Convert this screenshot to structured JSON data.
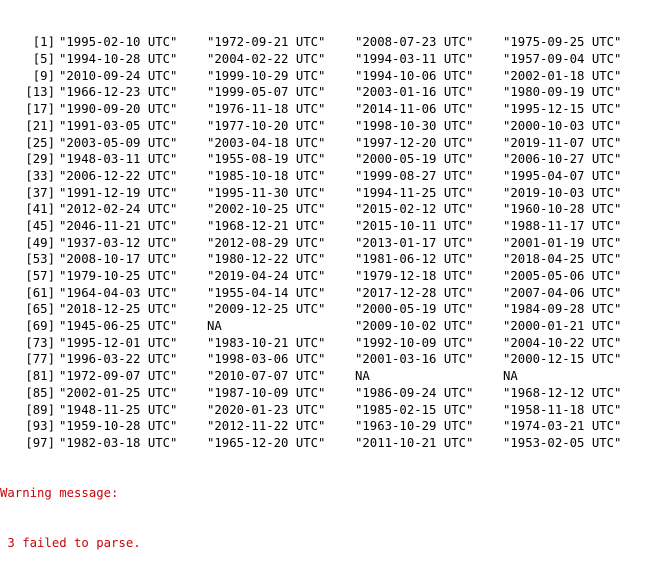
{
  "console": {
    "rows": [
      {
        "index": "[1]",
        "values": [
          "\"1995-02-10 UTC\"",
          "\"1972-09-21 UTC\"",
          "\"2008-07-23 UTC\"",
          "\"1975-09-25 UTC\""
        ]
      },
      {
        "index": "[5]",
        "values": [
          "\"1994-10-28 UTC\"",
          "\"2004-02-22 UTC\"",
          "\"1994-03-11 UTC\"",
          "\"1957-09-04 UTC\""
        ]
      },
      {
        "index": "[9]",
        "values": [
          "\"2010-09-24 UTC\"",
          "\"1999-10-29 UTC\"",
          "\"1994-10-06 UTC\"",
          "\"2002-01-18 UTC\""
        ]
      },
      {
        "index": "[13]",
        "values": [
          "\"1966-12-23 UTC\"",
          "\"1999-05-07 UTC\"",
          "\"2003-01-16 UTC\"",
          "\"1980-09-19 UTC\""
        ]
      },
      {
        "index": "[17]",
        "values": [
          "\"1990-09-20 UTC\"",
          "\"1976-11-18 UTC\"",
          "\"2014-11-06 UTC\"",
          "\"1995-12-15 UTC\""
        ]
      },
      {
        "index": "[21]",
        "values": [
          "\"1991-03-05 UTC\"",
          "\"1977-10-20 UTC\"",
          "\"1998-10-30 UTC\"",
          "\"2000-10-03 UTC\""
        ]
      },
      {
        "index": "[25]",
        "values": [
          "\"2003-05-09 UTC\"",
          "\"2003-04-18 UTC\"",
          "\"1997-12-20 UTC\"",
          "\"2019-11-07 UTC\""
        ]
      },
      {
        "index": "[29]",
        "values": [
          "\"1948-03-11 UTC\"",
          "\"1955-08-19 UTC\"",
          "\"2000-05-19 UTC\"",
          "\"2006-10-27 UTC\""
        ]
      },
      {
        "index": "[33]",
        "values": [
          "\"2006-12-22 UTC\"",
          "\"1985-10-18 UTC\"",
          "\"1999-08-27 UTC\"",
          "\"1995-04-07 UTC\""
        ]
      },
      {
        "index": "[37]",
        "values": [
          "\"1991-12-19 UTC\"",
          "\"1995-11-30 UTC\"",
          "\"1994-11-25 UTC\"",
          "\"2019-10-03 UTC\""
        ]
      },
      {
        "index": "[41]",
        "values": [
          "\"2012-02-24 UTC\"",
          "\"2002-10-25 UTC\"",
          "\"2015-02-12 UTC\"",
          "\"1960-10-28 UTC\""
        ]
      },
      {
        "index": "[45]",
        "values": [
          "\"2046-11-21 UTC\"",
          "\"1968-12-21 UTC\"",
          "\"2015-10-11 UTC\"",
          "\"1988-11-17 UTC\""
        ]
      },
      {
        "index": "[49]",
        "values": [
          "\"1937-03-12 UTC\"",
          "\"2012-08-29 UTC\"",
          "\"2013-01-17 UTC\"",
          "\"2001-01-19 UTC\""
        ]
      },
      {
        "index": "[53]",
        "values": [
          "\"2008-10-17 UTC\"",
          "\"1980-12-22 UTC\"",
          "\"1981-06-12 UTC\"",
          "\"2018-04-25 UTC\""
        ]
      },
      {
        "index": "[57]",
        "values": [
          "\"1979-10-25 UTC\"",
          "\"2019-04-24 UTC\"",
          "\"1979-12-18 UTC\"",
          "\"2005-05-06 UTC\""
        ]
      },
      {
        "index": "[61]",
        "values": [
          "\"1964-04-03 UTC\"",
          "\"1955-04-14 UTC\"",
          "\"2017-12-28 UTC\"",
          "\"2007-04-06 UTC\""
        ]
      },
      {
        "index": "[65]",
        "values": [
          "\"2018-12-25 UTC\"",
          "\"2009-12-25 UTC\"",
          "\"2000-05-19 UTC\"",
          "\"1984-09-28 UTC\""
        ]
      },
      {
        "index": "[69]",
        "values": [
          "\"1945-06-25 UTC\"",
          "NA",
          "\"2009-10-02 UTC\"",
          "\"2000-01-21 UTC\""
        ]
      },
      {
        "index": "[73]",
        "values": [
          "\"1995-12-01 UTC\"",
          "\"1983-10-21 UTC\"",
          "\"1992-10-09 UTC\"",
          "\"2004-10-22 UTC\""
        ]
      },
      {
        "index": "[77]",
        "values": [
          "\"1996-03-22 UTC\"",
          "\"1998-03-06 UTC\"",
          "\"2001-03-16 UTC\"",
          "\"2000-12-15 UTC\""
        ]
      },
      {
        "index": "[81]",
        "values": [
          "\"1972-09-07 UTC\"",
          "\"2010-07-07 UTC\"",
          "NA",
          "NA"
        ]
      },
      {
        "index": "[85]",
        "values": [
          "\"2002-01-25 UTC\"",
          "\"1987-10-09 UTC\"",
          "\"1986-09-24 UTC\"",
          "\"1968-12-12 UTC\""
        ]
      },
      {
        "index": "[89]",
        "values": [
          "\"1948-11-25 UTC\"",
          "\"2020-01-23 UTC\"",
          "\"1985-02-15 UTC\"",
          "\"1958-11-18 UTC\""
        ]
      },
      {
        "index": "[93]",
        "values": [
          "\"1959-10-28 UTC\"",
          "\"2012-11-22 UTC\"",
          "\"1963-10-29 UTC\"",
          "\"1974-03-21 UTC\""
        ]
      },
      {
        "index": "[97]",
        "values": [
          "\"1982-03-18 UTC\"",
          "\"1965-12-20 UTC\"",
          "\"2011-10-21 UTC\"",
          "\"1953-02-05 UTC\""
        ]
      }
    ],
    "warning": {
      "title": "Warning message:",
      "detail": " 3 failed to parse."
    }
  },
  "colors": {
    "text": "#000000",
    "warning": "#c5060b",
    "background": "#ffffff"
  }
}
